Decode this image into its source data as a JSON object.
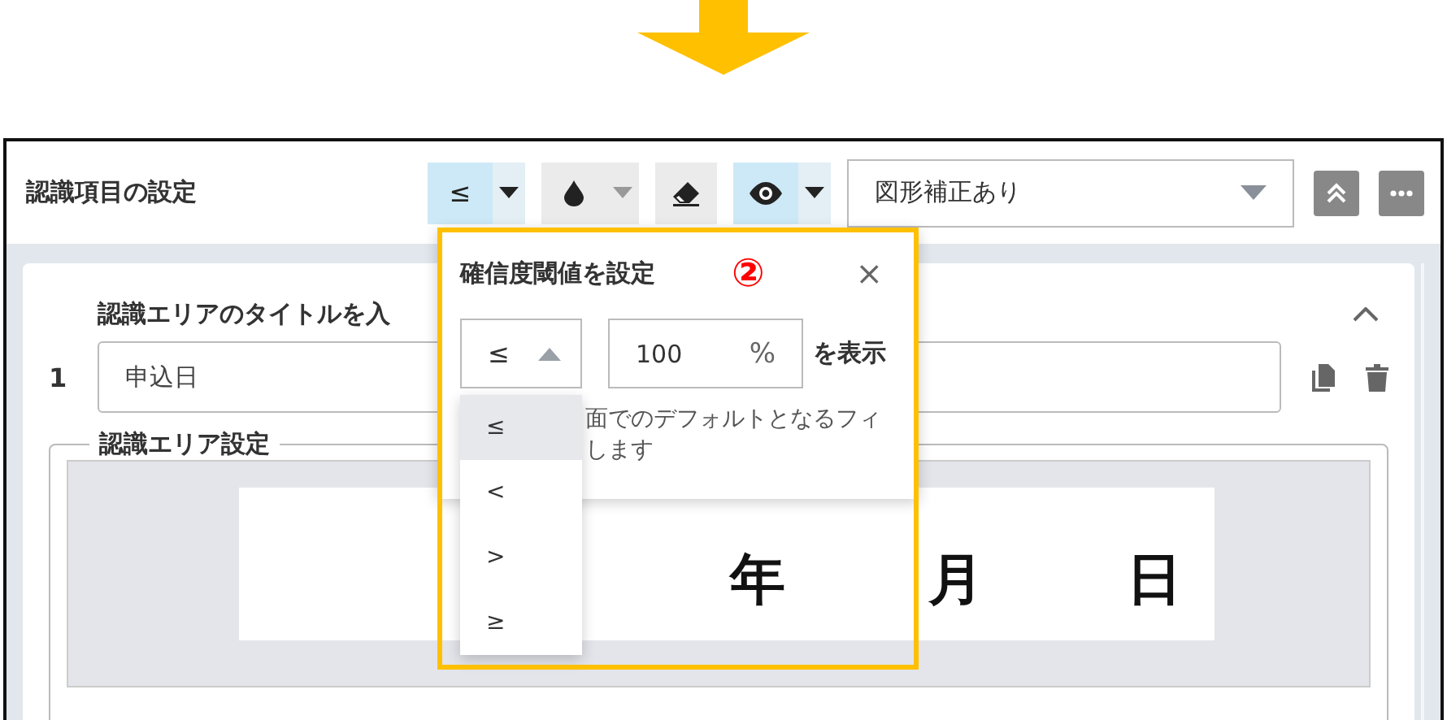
{
  "annotation": {
    "marker": "②"
  },
  "header": {
    "title": "認識項目の設定",
    "tools": [
      {
        "kind": "threshold",
        "label": "≤",
        "active": true,
        "caret_disabled": false
      },
      {
        "kind": "drop",
        "active": false,
        "caret_disabled": true
      },
      {
        "kind": "eraser",
        "active": false
      },
      {
        "kind": "eye",
        "active": true,
        "caret_disabled": false
      }
    ],
    "mode_select": {
      "value": "図形補正あり"
    }
  },
  "card": {
    "number": "1",
    "title_label": "認識エリアのタイトルを入",
    "title_value": "申込日",
    "area_legend": "認識エリア設定",
    "image_texts": [
      "年",
      "月",
      "日"
    ]
  },
  "popup": {
    "title": "確信度閾値を設定",
    "close": "×",
    "operator": "≤",
    "threshold": "100",
    "unit": "%",
    "suffix": "を表示",
    "note_lines": [
      "面でのデフォルトとなるフィ",
      "します"
    ],
    "options": [
      {
        "label": "≤",
        "selected": true
      },
      {
        "label": "<",
        "selected": false
      },
      {
        "label": ">",
        "selected": false
      },
      {
        "label": "≥",
        "selected": false
      }
    ]
  }
}
